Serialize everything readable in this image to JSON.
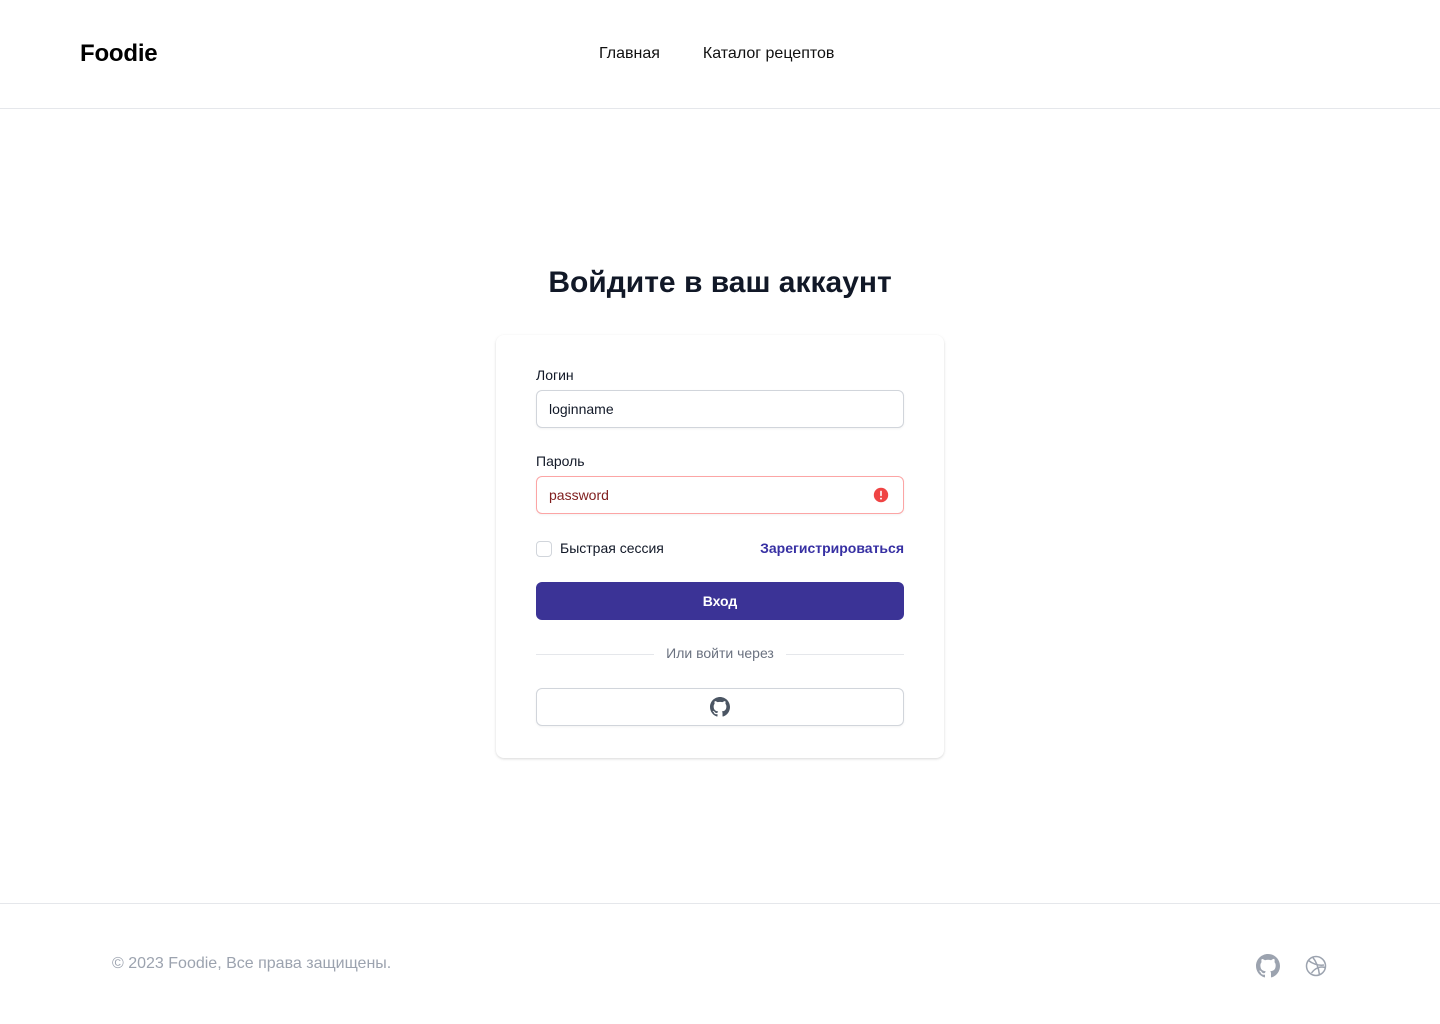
{
  "header": {
    "logo": "Foodie",
    "nav": [
      {
        "label": "Главная"
      },
      {
        "label": "Каталог рецептов"
      }
    ]
  },
  "main": {
    "title": "Войдите в ваш аккаунт",
    "form": {
      "login_label": "Логин",
      "login_value": "loginname",
      "password_label": "Пароль",
      "password_value": "password",
      "password_error": true,
      "remember_label": "Быстрая сессия",
      "remember_checked": false,
      "register_link": "Зарегистрироваться",
      "submit_label": "Вход",
      "divider_text": "Или войти через",
      "oauth_provider_icon": "github-icon"
    }
  },
  "footer": {
    "copyright": "© 2023 Foodie, Все права защищены.",
    "icons": [
      "github-icon",
      "dribbble-icon"
    ]
  },
  "colors": {
    "primary": "#3b3396",
    "link": "#3730a3",
    "error": "#ef4444",
    "error_border": "#fca5a5",
    "muted_text": "#9ca3af"
  }
}
